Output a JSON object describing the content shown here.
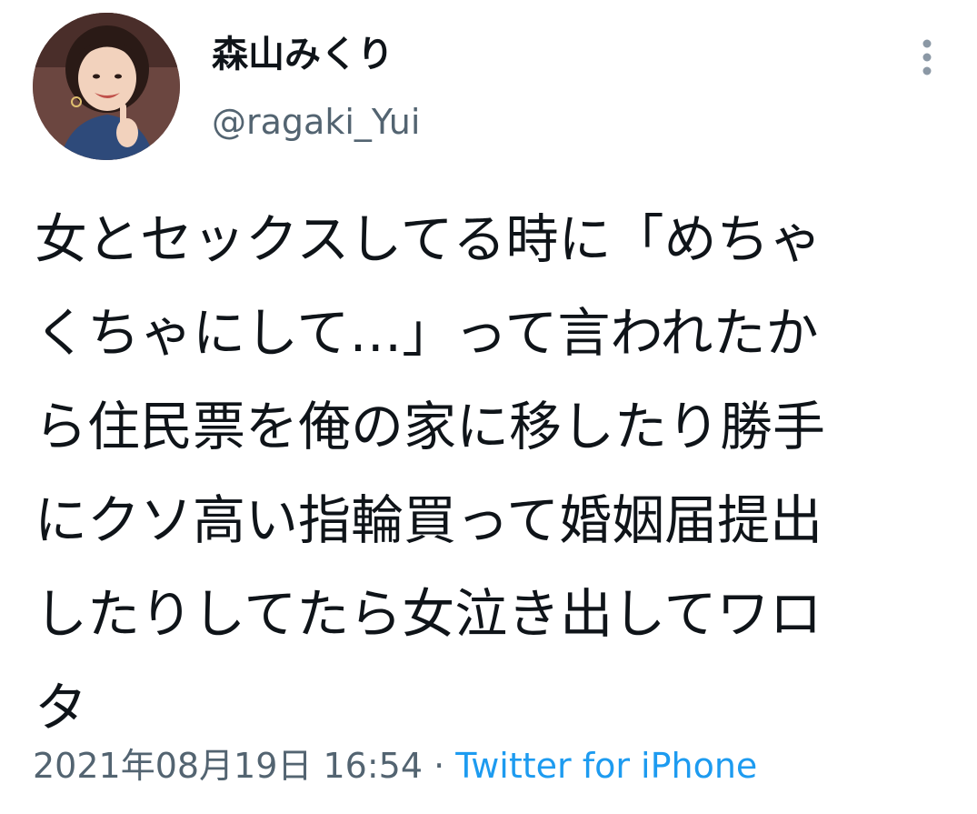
{
  "author": {
    "display_name": "森山みくり",
    "handle": "@ragaki_Yui",
    "avatar_icon": "profile-photo"
  },
  "more_icon": "more-vertical-icon",
  "tweet": {
    "lines": [
      "女とセックスしてる時に「めちゃ",
      "くちゃにして…」って言われたか",
      "ら住民票を俺の家に移したり勝手",
      "にクソ高い指輪買って婚姻届提出",
      "したりしてたら女泣き出してワロ",
      "タ"
    ]
  },
  "meta": {
    "timestamp": "2021年08月19日 16:54",
    "separator": " · ",
    "source": "Twitter for iPhone"
  },
  "colors": {
    "text": "#0f1419",
    "secondary": "#536471",
    "link": "#1d9bf0"
  }
}
